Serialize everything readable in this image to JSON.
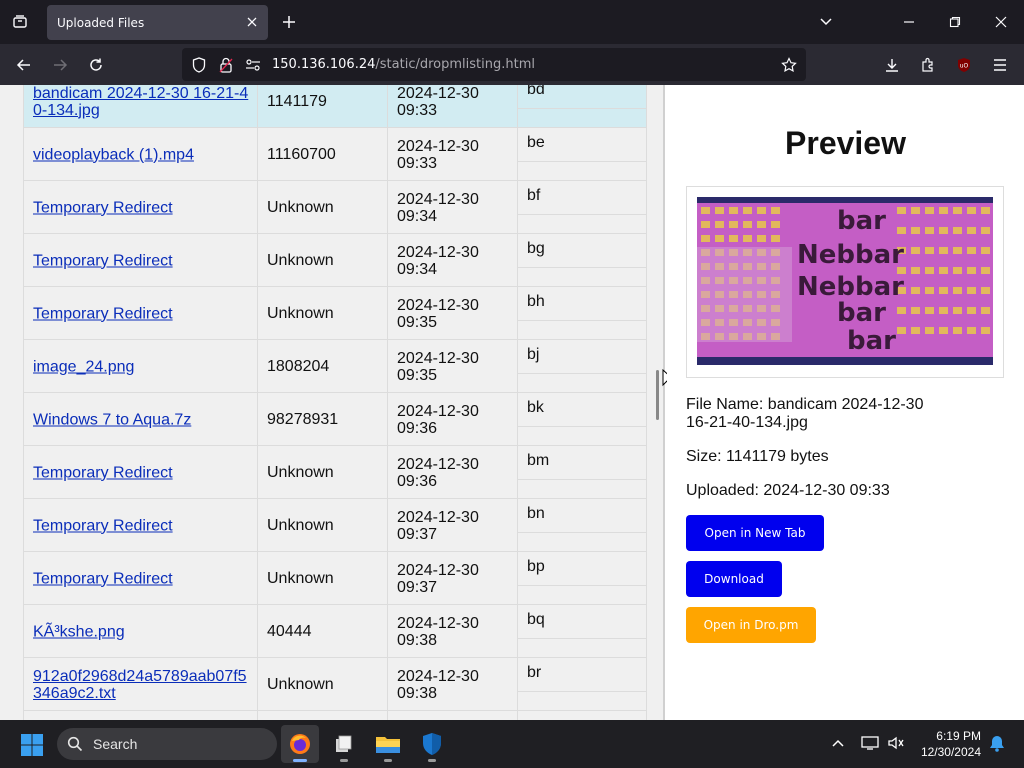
{
  "browser": {
    "tab_title": "Uploaded Files",
    "url_host": "150.136.106.24",
    "url_path": "/static/dropmlisting.html"
  },
  "listing": {
    "rows": [
      {
        "name": "bandicam 2024-12-30 16-21-40-134.jpg",
        "size": "1141179",
        "date": "2024-12-30 09:33",
        "code": "bd",
        "selected": true
      },
      {
        "name": "videoplayback (1).mp4",
        "size": "11160700",
        "date": "2024-12-30 09:33",
        "code": "be"
      },
      {
        "name": "Temporary Redirect",
        "size": "Unknown",
        "date": "2024-12-30 09:34",
        "code": "bf"
      },
      {
        "name": "Temporary Redirect",
        "size": "Unknown",
        "date": "2024-12-30 09:34",
        "code": "bg"
      },
      {
        "name": "Temporary Redirect",
        "size": "Unknown",
        "date": "2024-12-30 09:35",
        "code": "bh"
      },
      {
        "name": "image_24.png",
        "size": "1808204",
        "date": "2024-12-30 09:35",
        "code": "bj"
      },
      {
        "name": "Windows 7 to Aqua.7z",
        "size": "98278931",
        "date": "2024-12-30 09:36",
        "code": "bk"
      },
      {
        "name": "Temporary Redirect",
        "size": "Unknown",
        "date": "2024-12-30 09:36",
        "code": "bm"
      },
      {
        "name": "Temporary Redirect",
        "size": "Unknown",
        "date": "2024-12-30 09:37",
        "code": "bn"
      },
      {
        "name": "Temporary Redirect",
        "size": "Unknown",
        "date": "2024-12-30 09:37",
        "code": "bp"
      },
      {
        "name": "KÃ³kshe.png",
        "size": "40444",
        "date": "2024-12-30 09:38",
        "code": "bq"
      },
      {
        "name": "912a0f2968d24a5789aab07f5346a9c2.txt",
        "size": "Unknown",
        "date": "2024-12-30 09:38",
        "code": "br"
      },
      {
        "name": "",
        "size": "",
        "date": "",
        "code": ""
      }
    ]
  },
  "preview": {
    "title": "Preview",
    "file_name": "File Name: bandicam 2024-12-30 16-21-40-134.jpg",
    "size": "Size: 1141179 bytes",
    "uploaded": "Uploaded: 2024-12-30 09:33",
    "btn_open_tab": "Open in New Tab",
    "btn_download": "Download",
    "btn_open_dropm": "Open in Dro.pm",
    "image_text": [
      "bar",
      "Nebbar",
      "Nebbar",
      "bar",
      "bar"
    ]
  },
  "taskbar": {
    "search_label": "Search",
    "time": "6:19 PM",
    "date": "12/30/2024"
  },
  "colors": {
    "link": "#0a2db9",
    "selected_row": "#d2ecf2",
    "btn_blue": "#0000ee",
    "btn_orange": "#ffa500",
    "preview_bg": "#c45ec5"
  }
}
